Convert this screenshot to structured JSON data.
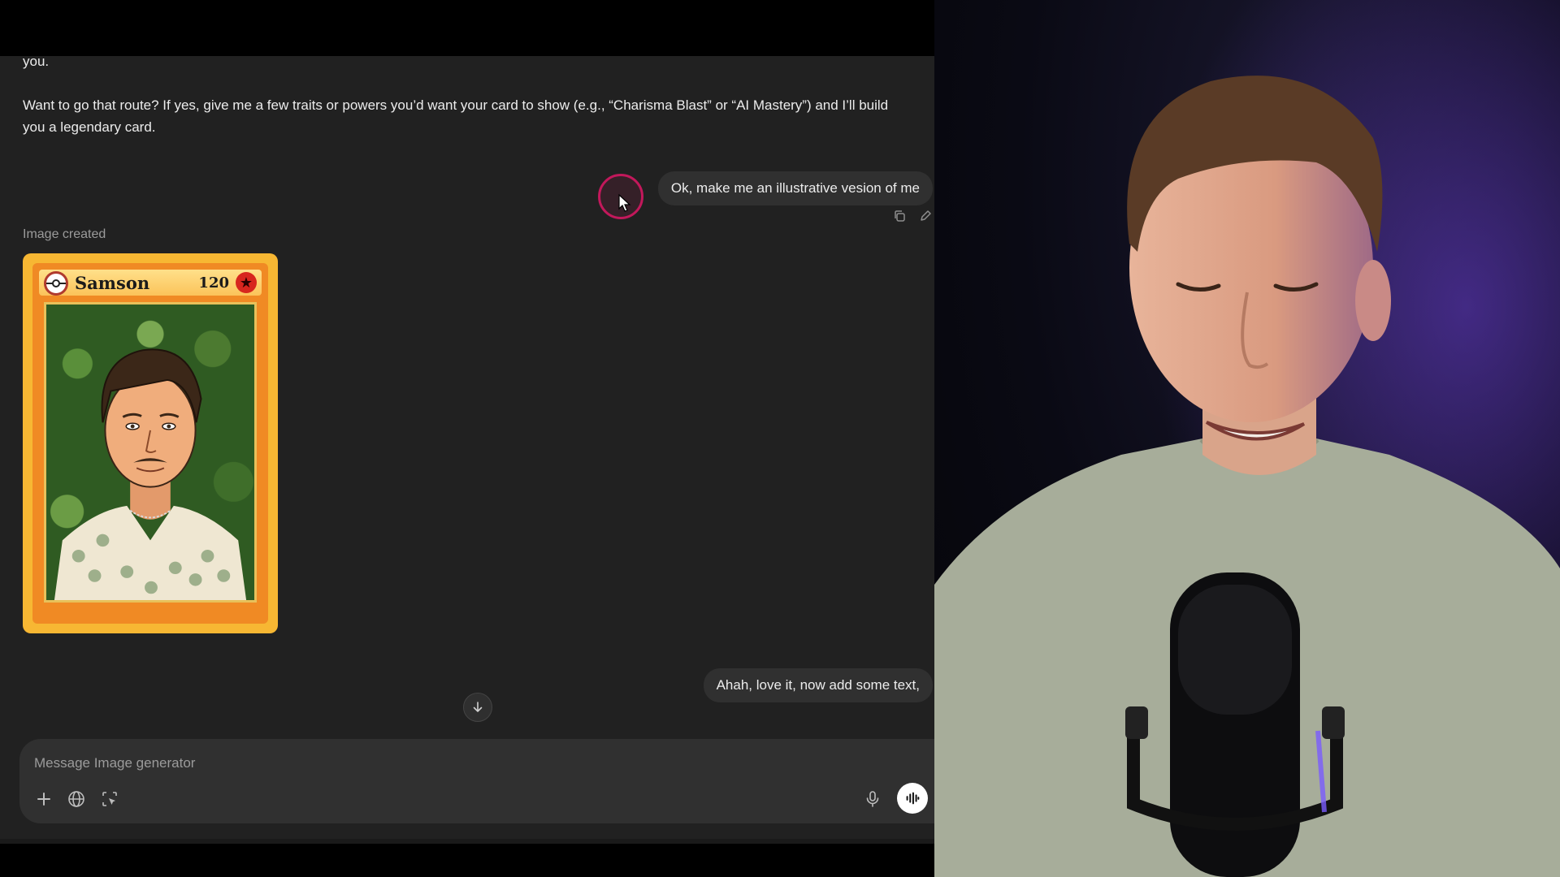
{
  "chat": {
    "assistant_partial": "you.",
    "assistant_route": "Want to go that route? If yes, give me a few traits or powers you’d want your card to show (e.g., “Charisma Blast” or “AI Mastery”) and I’ll build you a legendary card.",
    "user_message_1": "Ok, make me an illustrative vesion of me",
    "image_created_label": "Image created",
    "user_message_2": "Ahah, love it, now add some text,"
  },
  "card": {
    "name": "Samson",
    "hp": "120",
    "star": "★"
  },
  "composer": {
    "placeholder": "Message Image generator"
  },
  "icons": {
    "copy": "copy-icon",
    "edit": "pencil-icon",
    "scroll_down": "arrow-down-icon",
    "plus": "plus-icon",
    "globe": "globe-icon",
    "select": "select-area-icon",
    "mic": "microphone-icon",
    "voice": "voice-mode-icon"
  },
  "colors": {
    "chat_background": "#212121",
    "bubble_background": "#303030",
    "card_gold": "#f7b733",
    "cursor_ring": "#c2185b"
  }
}
